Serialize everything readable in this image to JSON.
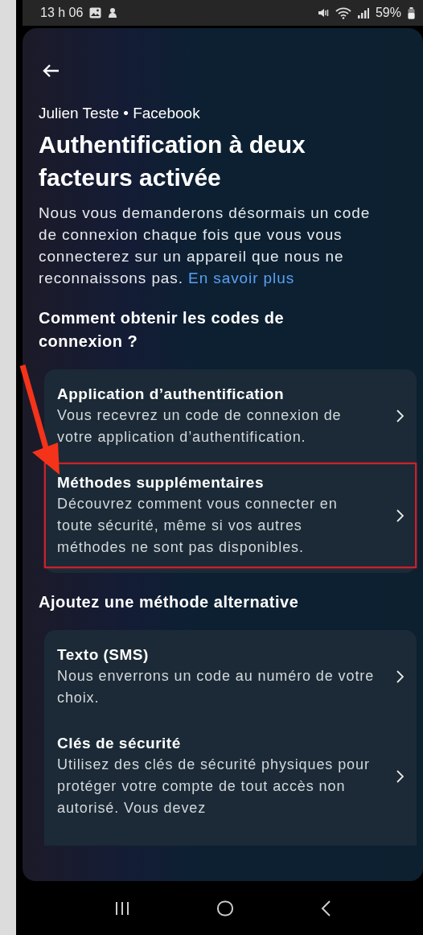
{
  "status_bar": {
    "time": "13 h 06",
    "battery": "59%"
  },
  "account": "Julien Teste • Facebook",
  "title": "Authentification à deux facteurs activée",
  "description": "Nous vous demanderons désormais un code de connexion chaque fois que vous vous connecterez sur un appareil que nous ne reconnaissons pas.",
  "learn_more": "En savoir plus",
  "sections": [
    {
      "heading": "Comment obtenir les codes de connexion ?",
      "items": [
        {
          "title": "Application d’authentification",
          "description": "Vous recevrez un code de connexion de votre application d’authentification.",
          "highlighted": false
        },
        {
          "title": "Méthodes supplémentaires",
          "description": "Découvrez comment vous connecter en toute sécurité, même si vos autres méthodes ne sont pas disponibles.",
          "highlighted": true
        }
      ]
    },
    {
      "heading": "Ajoutez une méthode alternative",
      "items": [
        {
          "title": "Texto (SMS)",
          "description": "Nous enverrons un code au numéro de votre choix.",
          "highlighted": false
        },
        {
          "title": "Clés de sécurité",
          "description": "Utilisez des clés de sécurité physiques pour protéger votre compte de tout accès non autorisé. Vous devez",
          "highlighted": false
        }
      ]
    }
  ]
}
